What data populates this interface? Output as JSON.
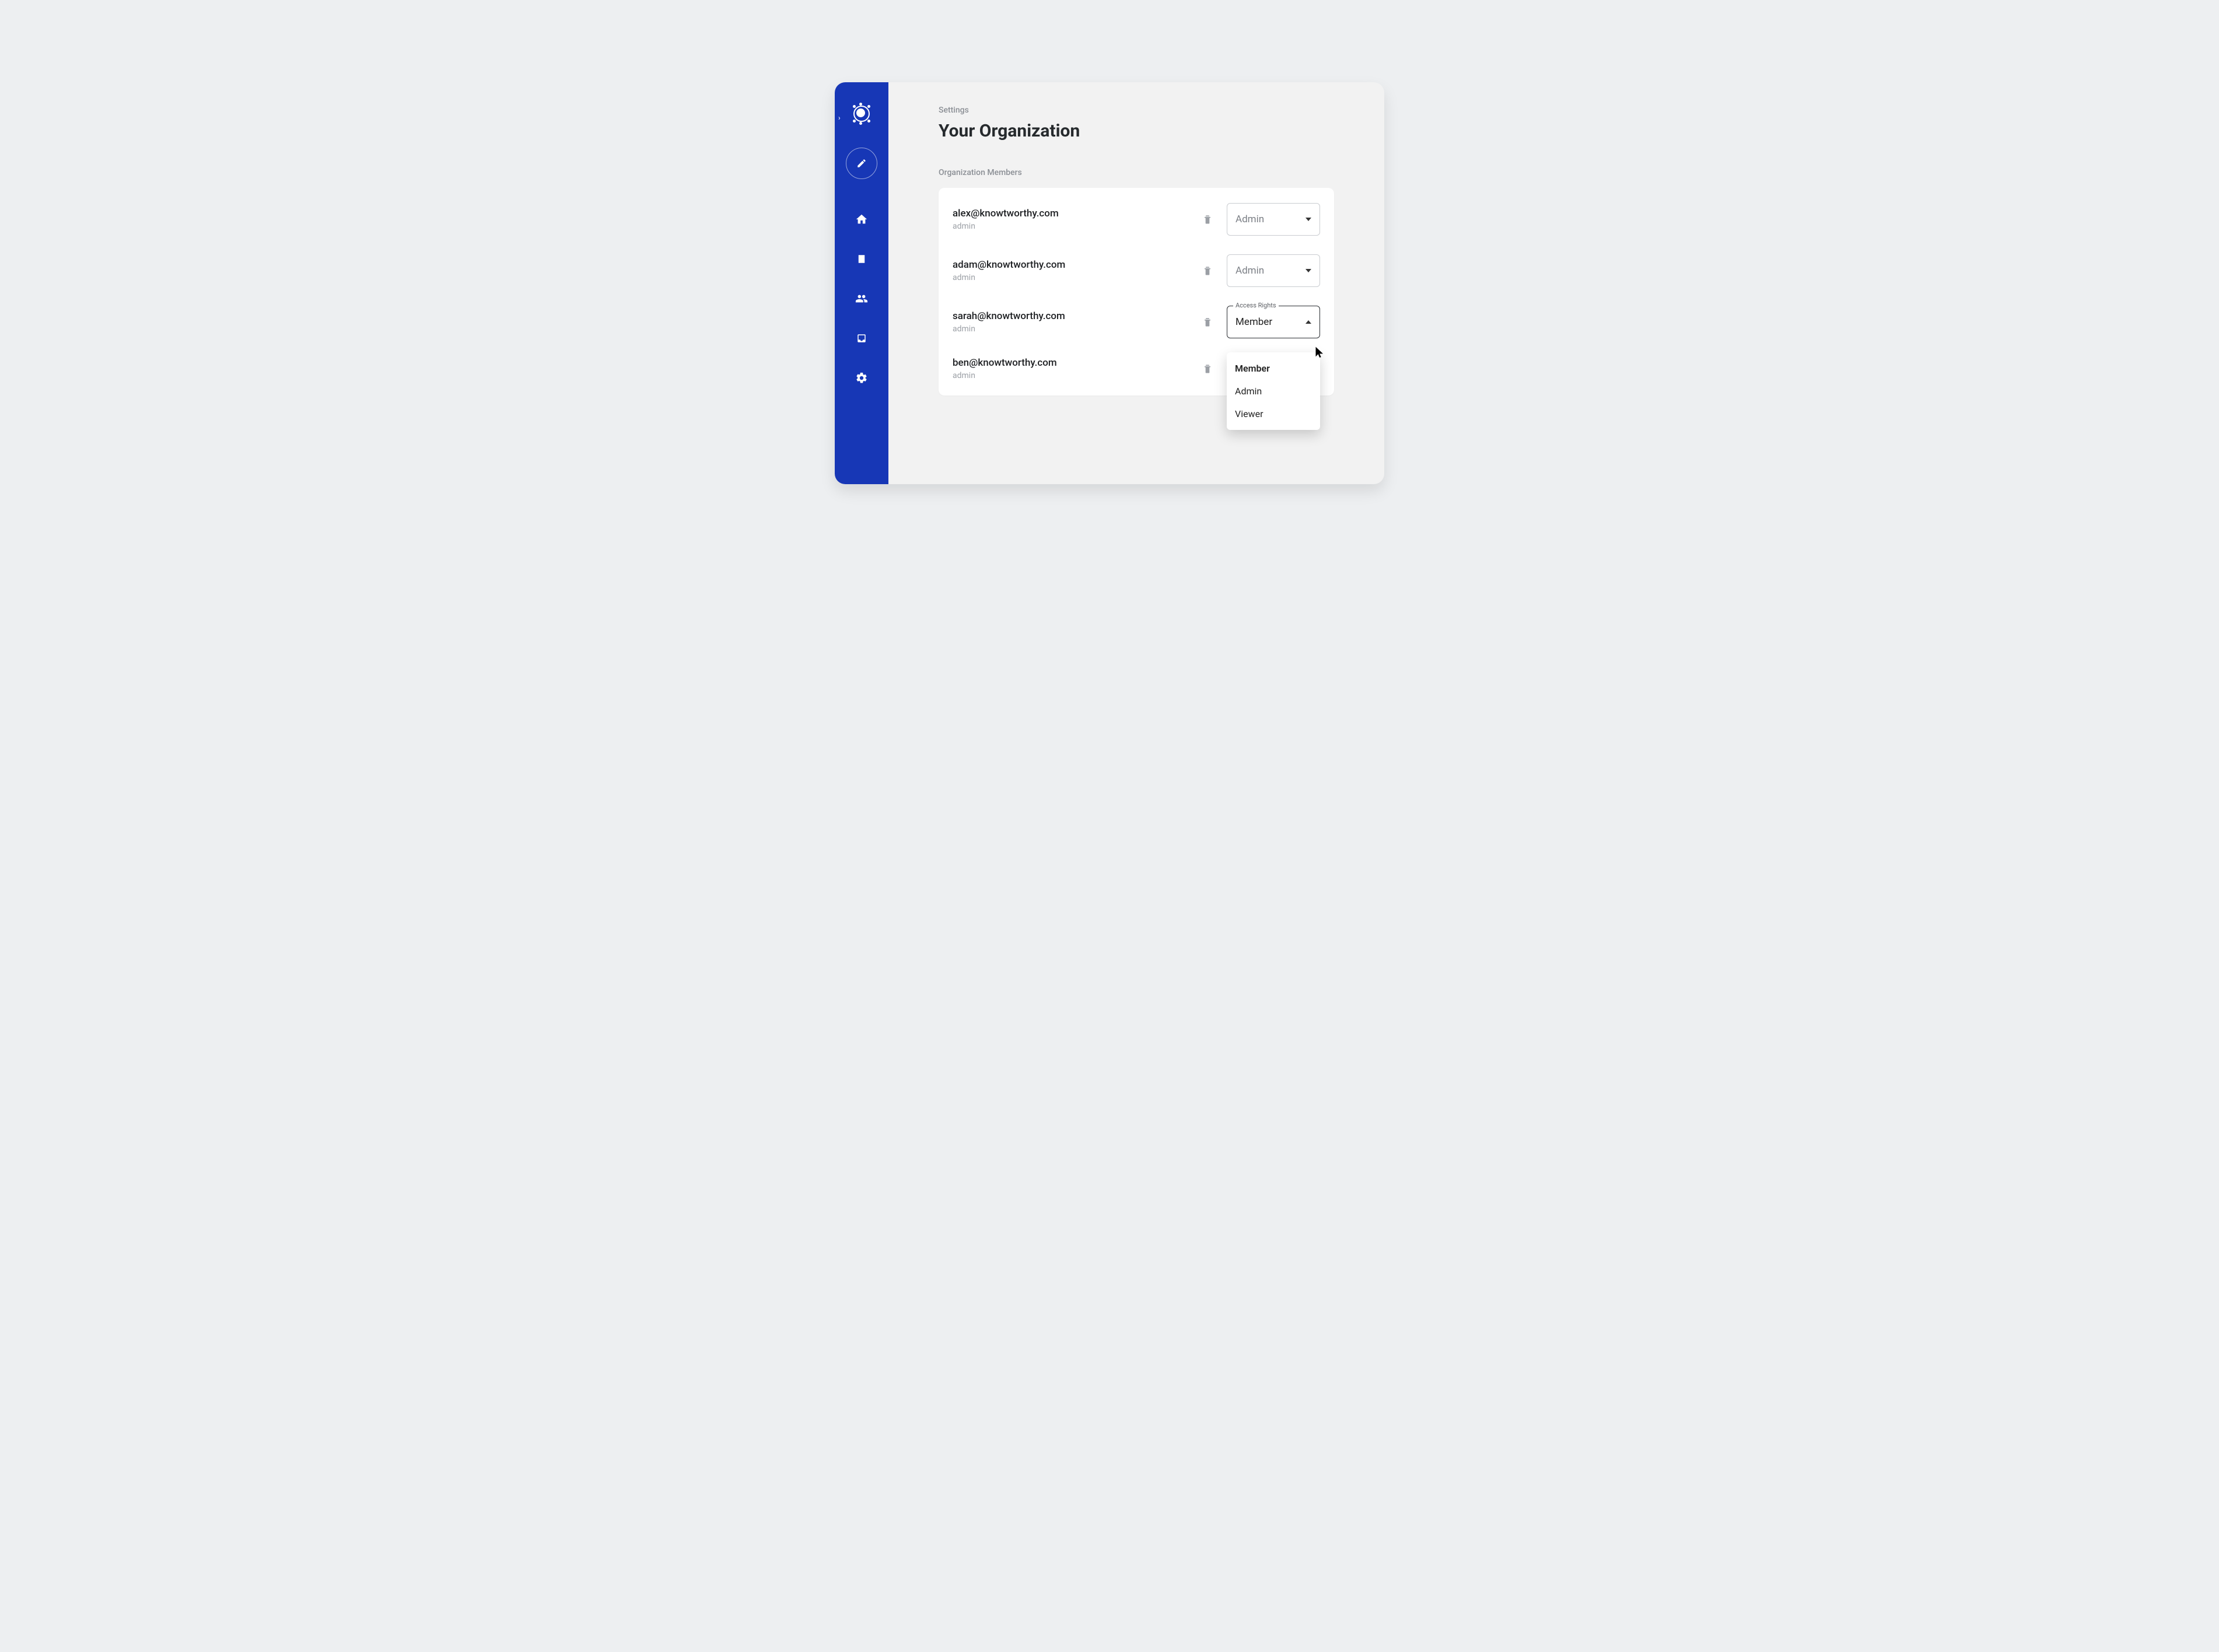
{
  "breadcrumb": "Settings",
  "page_title": "Your Organization",
  "section_label": "Organization Members",
  "select_label": "Access Rights",
  "members": [
    {
      "email": "alex@knowtworthy.com",
      "role": "admin",
      "access": "Admin",
      "open": false
    },
    {
      "email": "adam@knowtworthy.com",
      "role": "admin",
      "access": "Admin",
      "open": false
    },
    {
      "email": "sarah@knowtworthy.com",
      "role": "admin",
      "access": "Member",
      "open": true
    },
    {
      "email": "ben@knowtworthy.com",
      "role": "admin",
      "access": "",
      "open": false,
      "hide_select": true
    }
  ],
  "options": [
    "Member",
    "Admin",
    "Viewer"
  ]
}
